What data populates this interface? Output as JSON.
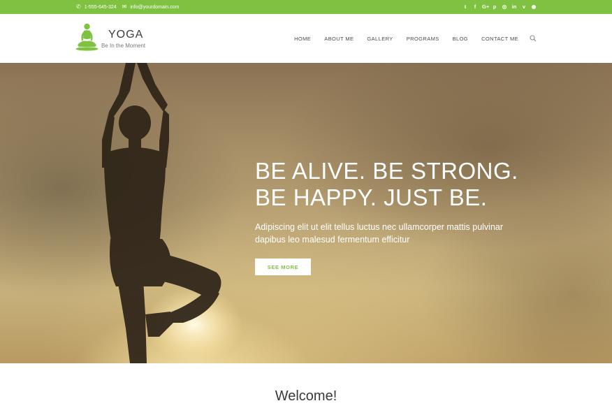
{
  "topbar": {
    "phone": "1-555-645-324",
    "email": "info@yourdomain.com",
    "social_icons": [
      "twitter-icon",
      "facebook-icon",
      "google-plus-icon",
      "pinterest-icon",
      "instagram-icon",
      "linkedin-icon",
      "vimeo-icon",
      "rss-icon"
    ],
    "social_glyphs": [
      "t",
      "f",
      "G+",
      "p",
      "◎",
      "in",
      "v",
      "◉"
    ],
    "bg_color": "#7fc241"
  },
  "header": {
    "logo_title": "YOGA",
    "logo_tagline": "Be In the Moment",
    "logo_color": "#7fc241",
    "nav": [
      "HOME",
      "ABOUT ME",
      "GALLERY",
      "PROGRAMS",
      "BLOG",
      "CONTACT ME"
    ]
  },
  "hero": {
    "headline_line1": "BE ALIVE. BE STRONG.",
    "headline_line2": "BE HAPPY. JUST BE.",
    "description": "Adipiscing elit ut elit tellus luctus nec ullamcorper mattis pulvinar dapibus leo malesud fermentum efficitur",
    "button_label": "SEE MORE"
  },
  "welcome": {
    "title": "Welcome!"
  }
}
